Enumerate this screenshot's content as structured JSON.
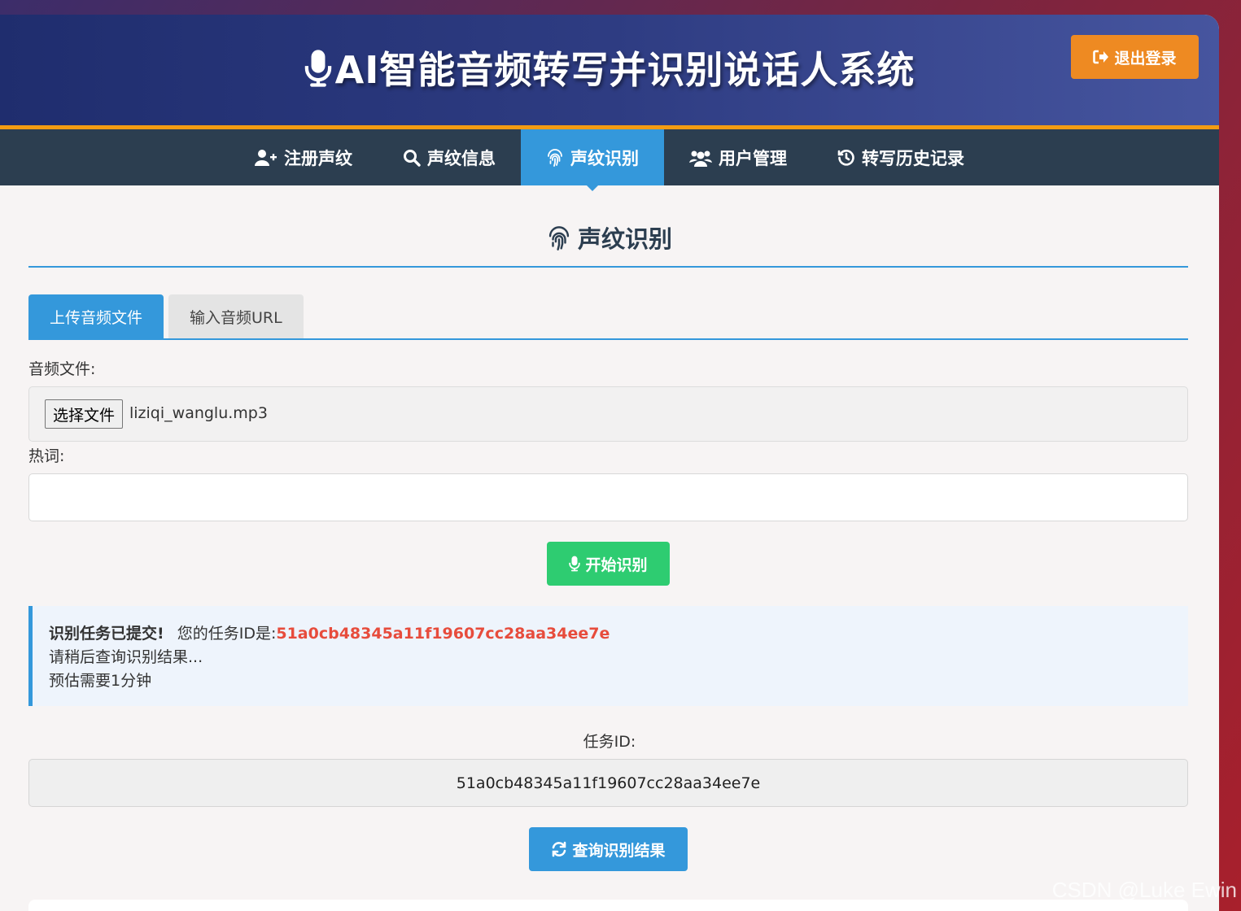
{
  "header": {
    "title": "AI智能音频转写并识别说话人系统",
    "logout_label": "退出登录"
  },
  "nav": {
    "items": [
      {
        "label": "注册声纹",
        "icon": "user-plus-icon"
      },
      {
        "label": "声纹信息",
        "icon": "search-icon"
      },
      {
        "label": "声纹识别",
        "icon": "fingerprint-icon",
        "active": true
      },
      {
        "label": "用户管理",
        "icon": "users-icon"
      },
      {
        "label": "转写历史记录",
        "icon": "history-icon"
      }
    ]
  },
  "main": {
    "title": "声纹识别",
    "tabs": [
      {
        "label": "上传音频文件",
        "active": true
      },
      {
        "label": "输入音频URL",
        "active": false
      }
    ],
    "audio_label": "音频文件:",
    "file_button_label": "选择文件",
    "file_name": "liziqi_wanglu.mp3",
    "hotword_label": "热词:",
    "hotword_value": "",
    "start_button_label": "开始识别",
    "notice": {
      "strong": "识别任务已提交!",
      "prefix": "您的任务ID是:",
      "task_id": "51a0cb48345a11f19607cc28aa34ee7e",
      "line2": "请稍后查询识别结果...",
      "line3": "预估需要1分钟"
    },
    "task_id_label": "任务ID:",
    "task_id_value": "51a0cb48345a11f19607cc28aa34ee7e",
    "query_button_label": "查询识别结果"
  },
  "watermark": "CSDN @Luke Ewin",
  "colors": {
    "header_bg": "#2e3c82",
    "accent_orange": "#f39c12",
    "nav_bg": "#2c3e50",
    "primary_blue": "#3498db",
    "success_green": "#2ecc71",
    "task_id_red": "#e74c3c"
  }
}
